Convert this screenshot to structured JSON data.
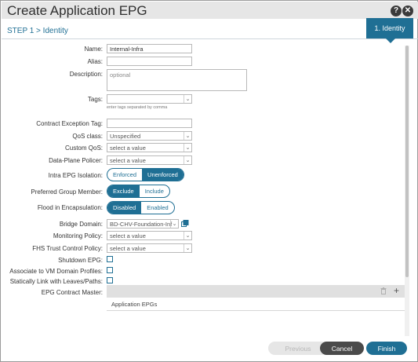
{
  "window": {
    "title": "Create Application EPG",
    "help_glyph": "?",
    "close_glyph": "✕"
  },
  "step": {
    "breadcrumb": "STEP 1 > Identity",
    "tab_label": "1. Identity"
  },
  "form": {
    "name": {
      "label": "Name:",
      "value": "Internal-Infra"
    },
    "alias": {
      "label": "Alias:",
      "value": ""
    },
    "description": {
      "label": "Description:",
      "placeholder": "optional"
    },
    "tags": {
      "label": "Tags:",
      "value": "",
      "hint": "enter tags separated by comma"
    },
    "contract_exception_tag": {
      "label": "Contract Exception Tag:",
      "value": ""
    },
    "qos_class": {
      "label": "QoS class:",
      "value": "Unspecified"
    },
    "custom_qos": {
      "label": "Custom QoS:",
      "value": "select a value"
    },
    "data_plane_policer": {
      "label": "Data-Plane Policer:",
      "value": "select a value"
    },
    "intra_epg_isolation": {
      "label": "Intra EPG Isolation:",
      "options": [
        "Enforced",
        "Unenforced"
      ],
      "selected": "Unenforced"
    },
    "preferred_group_member": {
      "label": "Preferred Group Member:",
      "options": [
        "Exclude",
        "Include"
      ],
      "selected": "Exclude"
    },
    "flood_in_encapsulation": {
      "label": "Flood in Encapsulation:",
      "options": [
        "Disabled",
        "Enabled"
      ],
      "selected": "Disabled"
    },
    "bridge_domain": {
      "label": "Bridge Domain:",
      "value": "BD-CHV-Foundation-Inf"
    },
    "monitoring_policy": {
      "label": "Monitoring Policy:",
      "value": "select a value"
    },
    "fhs_trust_control_policy": {
      "label": "FHS Trust Control Policy:",
      "value": "select a value"
    },
    "shutdown_epg": {
      "label": "Shutdown EPG:",
      "checked": false
    },
    "associate_vm_domain": {
      "label": "Associate to VM Domain Profiles:",
      "checked": false
    },
    "static_link": {
      "label": "Statically Link with Leaves/Paths:",
      "checked": false
    },
    "epg_contract_master": {
      "label": "EPG Contract Master:",
      "column_header": "Application EPGs"
    }
  },
  "footer": {
    "previous_label": "Previous",
    "cancel_label": "Cancel",
    "finish_label": "Finish"
  },
  "icons": {
    "chevron": "⌄",
    "plus": "+"
  },
  "colors": {
    "accent": "#1f6f94",
    "header_bg": "#e6e6e6",
    "cancel_bg": "#4a4a4a"
  }
}
